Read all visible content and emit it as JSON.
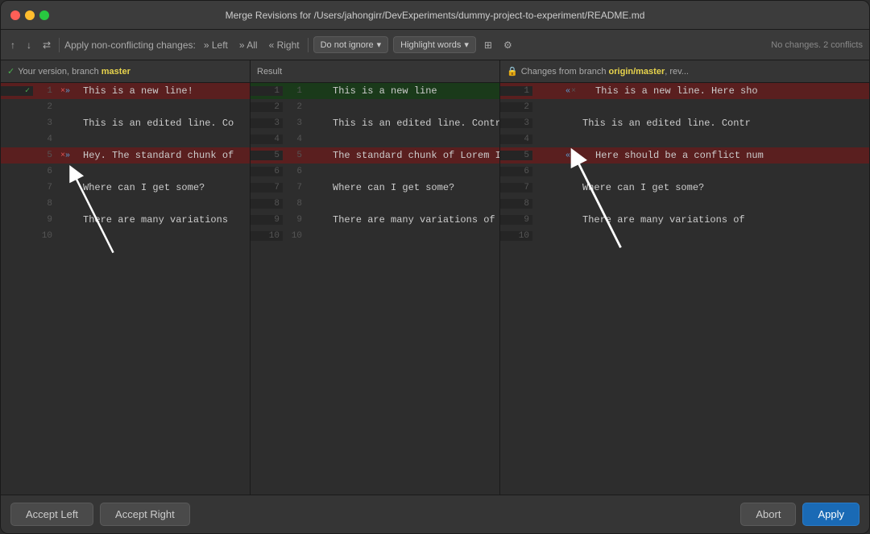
{
  "window": {
    "title": "Merge Revisions for /Users/jahongirr/DevExperiments/dummy-project-to-experiment/README.md"
  },
  "toolbar": {
    "up_arrow": "↑",
    "down_arrow": "↓",
    "apply_non_conflicting_label": "Apply non-conflicting changes:",
    "left_label": "» Left",
    "all_label": "» All",
    "right_label": "« Right",
    "ignore_dropdown": "Do not ignore",
    "highlight_words_label": "Highlight words",
    "status": "No changes. 2 conflicts"
  },
  "panels": {
    "left": {
      "header": "✓ Your version, branch master",
      "header_prefix": "✓ Your version, branch ",
      "branch": "master"
    },
    "result": {
      "header": "Result"
    },
    "right": {
      "header_prefix": "🔒 Changes from branch ",
      "branch": "origin/master",
      "header_suffix": ", rev..."
    }
  },
  "lines": {
    "left": [
      {
        "num": 1,
        "text": "This is a new line!",
        "type": "conflict",
        "controls": [
          "×",
          "»"
        ]
      },
      {
        "num": 2,
        "text": "",
        "type": "normal"
      },
      {
        "num": 3,
        "text": "This is an edited line. Co",
        "type": "normal"
      },
      {
        "num": 4,
        "text": "",
        "type": "normal"
      },
      {
        "num": 5,
        "text": "Hey. The standard chunk of",
        "type": "conflict",
        "controls": [
          "×",
          "»"
        ]
      },
      {
        "num": 6,
        "text": "",
        "type": "normal"
      },
      {
        "num": 7,
        "text": "Where can I get some?",
        "type": "normal"
      },
      {
        "num": 8,
        "text": "",
        "type": "normal"
      },
      {
        "num": 9,
        "text": "There are many variations",
        "type": "normal"
      },
      {
        "num": 10,
        "text": "",
        "type": "normal"
      }
    ],
    "result": [
      {
        "lnum": 1,
        "rnum": 1,
        "text": "This is a new line",
        "type": "accepted"
      },
      {
        "lnum": 2,
        "rnum": 2,
        "text": "",
        "type": "normal"
      },
      {
        "lnum": 3,
        "rnum": 3,
        "text": "This is an edited line. Contra",
        "type": "normal"
      },
      {
        "lnum": 4,
        "rnum": 4,
        "text": "",
        "type": "normal"
      },
      {
        "lnum": 5,
        "rnum": 5,
        "text": "The standard chunk of Lorem Ip",
        "type": "conflict"
      },
      {
        "lnum": 6,
        "rnum": 6,
        "text": "",
        "type": "normal"
      },
      {
        "lnum": 7,
        "rnum": 7,
        "text": "Where can I get some?",
        "type": "normal"
      },
      {
        "lnum": 8,
        "rnum": 8,
        "text": "",
        "type": "normal"
      },
      {
        "lnum": 9,
        "rnum": 9,
        "text": "There are many variations of p",
        "type": "normal"
      },
      {
        "lnum": 10,
        "rnum": 10,
        "text": "",
        "type": "normal"
      }
    ],
    "right": [
      {
        "num": 1,
        "text": "This is a new line. Here sho",
        "type": "conflict",
        "controls": [
          "«",
          "×"
        ]
      },
      {
        "num": 2,
        "text": "",
        "type": "normal"
      },
      {
        "num": 3,
        "text": "This is an edited line. Contr",
        "type": "normal"
      },
      {
        "num": 4,
        "text": "",
        "type": "normal"
      },
      {
        "num": 5,
        "text": "Here should be a conflict num",
        "type": "conflict",
        "controls": [
          "«",
          "×"
        ]
      },
      {
        "num": 6,
        "text": "",
        "type": "normal"
      },
      {
        "num": 7,
        "text": "Where can I get some?",
        "type": "normal"
      },
      {
        "num": 8,
        "text": "",
        "type": "normal"
      },
      {
        "num": 9,
        "text": "There are many variations of",
        "type": "normal"
      },
      {
        "num": 10,
        "text": "",
        "type": "normal"
      }
    ]
  },
  "buttons": {
    "accept_left": "Accept Left",
    "accept_right": "Accept Right",
    "abort": "Abort",
    "apply": "Apply"
  }
}
